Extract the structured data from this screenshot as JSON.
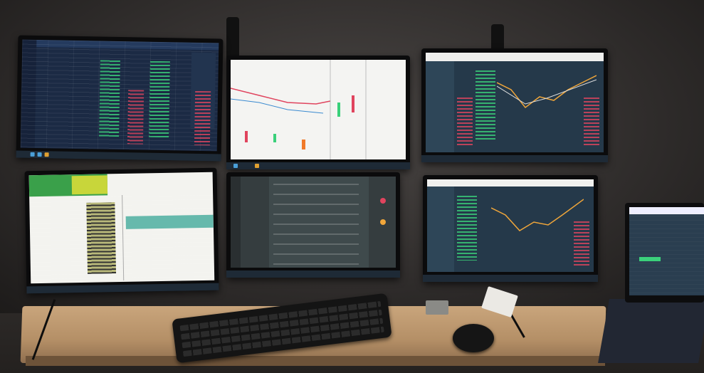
{
  "scene": {
    "monitor_screens": [
      {
        "id": "top-left",
        "theme": "#1b2a44",
        "accent": "#3ad07a"
      },
      {
        "id": "top-center",
        "theme": "#f4f4f2",
        "accent": "#e0445e"
      },
      {
        "id": "top-right",
        "theme": "#25394a",
        "accent": "#f0a63a"
      },
      {
        "id": "bottom-left",
        "theme": "#f3f3ef",
        "accent": "#c8d63a"
      },
      {
        "id": "bottom-center",
        "theme": "#3f4a4c",
        "accent": "#e0445e"
      },
      {
        "id": "bottom-right",
        "theme": "#25394a",
        "accent": "#f0a63a"
      },
      {
        "id": "laptop",
        "theme": "#2a3e50",
        "accent": "#3ad07a"
      }
    ],
    "colors": {
      "wall": "#3a3735",
      "desk": "#c9a57c",
      "device": "#0b0b0c"
    }
  }
}
